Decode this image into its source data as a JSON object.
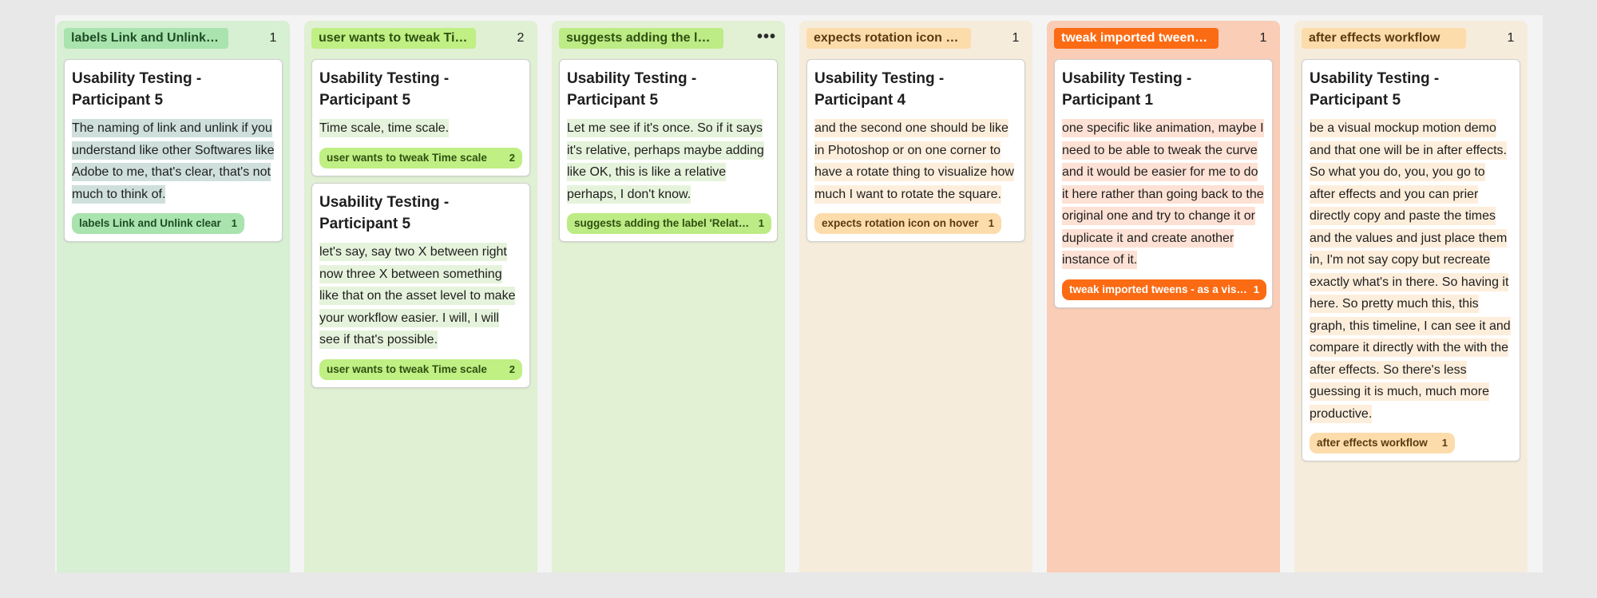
{
  "columns": [
    {
      "title": "labels Link and Unlink clear",
      "count": "1",
      "colors": {
        "background": "#d7efd3",
        "header": "#a9e3ae",
        "header_text": "#1f4d26"
      },
      "cards": [
        {
          "title": "Usability Testing - Participant 5",
          "body": "The naming of link and unlink if you understand like other Softwares like Adobe to me, that's clear, that's not much to think of.",
          "highlight": "#cfe0dc",
          "tag": {
            "label": "labels Link and Unlink clear",
            "count": "1",
            "bg": "#a9e3ae",
            "color": "#1f4d26"
          }
        }
      ]
    },
    {
      "title": "user wants to tweak Time scale",
      "count": "2",
      "colors": {
        "background": "#e0f0d3",
        "header": "#c0ef84",
        "header_text": "#2f5010"
      },
      "cards": [
        {
          "title": "Usability Testing - Participant 5",
          "body": "Time scale, time scale.",
          "highlight": "#e6f3dc",
          "tag": {
            "label": "user wants to tweak Time scale",
            "count": "2",
            "bg": "#c0ef84",
            "color": "#2f5010"
          }
        },
        {
          "title": "Usability Testing - Participant 5",
          "body": "let's say, say two X between right now three X between something like that on the asset level to make your workflow easier. I will, I will see if that's possible.",
          "highlight": "#e6f3dc",
          "tag": {
            "label": "user wants to tweak Time scale",
            "count": "2",
            "bg": "#c0ef84",
            "color": "#2f5010"
          }
        }
      ]
    },
    {
      "title": "suggests adding the label 'Relative'",
      "menu_icon": "more-horizontal-icon",
      "colors": {
        "background": "#e2f0d4",
        "header": "#bdeb85",
        "header_text": "#2f5010"
      },
      "cards": [
        {
          "title": "Usability Testing - Participant 5",
          "body": "Let me see if it's once. So if it says it's relative, perhaps maybe adding like OK, this is like a relative perhaps, I don't know.",
          "highlight": "#e6f3dc",
          "tag": {
            "label": "suggests adding the label 'Relative'",
            "count": "1",
            "bg": "#bdeb85",
            "color": "#2f5010"
          }
        }
      ]
    },
    {
      "title": "expects rotation icon on hover",
      "count": "1",
      "colors": {
        "background": "#f6ecdc",
        "header": "#fddcab",
        "header_text": "#5a3a10"
      },
      "cards": [
        {
          "title": "Usability Testing - Participant 4",
          "body": "and the second one should be like in Photoshop or on one corner to have a rotate thing to visualize how much I want to rotate the square.",
          "highlight": "#fdeedc",
          "tag": {
            "label": "expects rotation icon on hover",
            "count": "1",
            "bg": "#fddcab",
            "color": "#5a3a10"
          }
        }
      ]
    },
    {
      "title": "tweak imported tweens - as a visual mockup",
      "count": "1",
      "colors": {
        "background": "#f9cdb6",
        "header": "#fb6b14",
        "header_text": "#ffffff"
      },
      "cards": [
        {
          "title": "Usability Testing - Participant 1",
          "body": "one specific like animation, maybe I need to be able to tweak the curve and it would be easier for me to do it here rather than going back to the original one and try to change it or duplicate it and create another instance of it.",
          "highlight": "#fde1d4",
          "tag": {
            "label": "tweak imported tweens - as a visual mockup",
            "count": "1",
            "bg": "#fb6b14",
            "color": "#ffffff"
          }
        }
      ]
    },
    {
      "title": "after effects workflow",
      "count": "1",
      "colors": {
        "background": "#f6ecdc",
        "header": "#fddcab",
        "header_text": "#5a3a10"
      },
      "cards": [
        {
          "title": "Usability Testing - Participant 5",
          "body": "be a visual mockup motion demo and that one will be in after effects. So what you do, you, you go to after effects and you can prier directly copy and paste the times and the values and just place them in, I'm not say copy but recreate exactly what's in there. So having it here. So pretty much this, this graph, this timeline, I can see it and compare it directly with the with the after effects. So there's less guessing it is much, much more productive.",
          "highlight": "#fdeedc",
          "tag": {
            "label": "after effects workflow",
            "count": "1",
            "bg": "#fddcab",
            "color": "#5a3a10"
          }
        }
      ]
    }
  ]
}
